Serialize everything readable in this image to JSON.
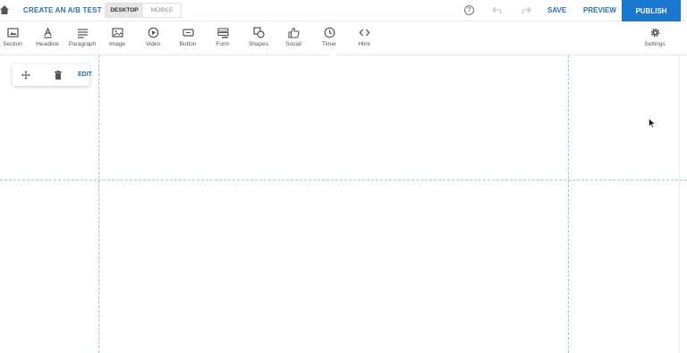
{
  "topbar": {
    "ab_test_label": "CREATE AN A/B TEST",
    "device_options": [
      "DESKTOP",
      "MOBILE"
    ],
    "active_device": "DESKTOP",
    "help_icon": "help-circle-icon",
    "save_label": "SAVE",
    "preview_label": "PREVIEW",
    "publish_label": "PUBLISH"
  },
  "toolbar": {
    "items": [
      {
        "label": "Section",
        "icon": "section-icon"
      },
      {
        "label": "Headline",
        "icon": "headline-icon"
      },
      {
        "label": "Paragraph",
        "icon": "paragraph-icon"
      },
      {
        "label": "Image",
        "icon": "image-icon"
      },
      {
        "label": "Video",
        "icon": "video-icon"
      },
      {
        "label": "Button",
        "icon": "button-icon"
      },
      {
        "label": "Form",
        "icon": "form-icon"
      },
      {
        "label": "Shapes",
        "icon": "shapes-icon"
      },
      {
        "label": "Social",
        "icon": "social-icon"
      },
      {
        "label": "Timer",
        "icon": "timer-icon"
      },
      {
        "label": "Html",
        "icon": "html-icon"
      }
    ],
    "settings_label": "Settings"
  },
  "section_tools": {
    "edit_label": "EDIT"
  },
  "colors": {
    "accent": "#2d6fb3",
    "publish_bg": "#1a78d2",
    "guide": "#8fd3e6"
  }
}
